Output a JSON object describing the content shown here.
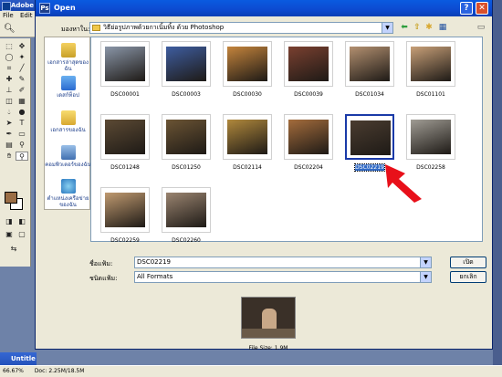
{
  "photoshop": {
    "title": "Adobe P",
    "menu": [
      "File",
      "Edit",
      "I"
    ],
    "doc_tab": "Untitle",
    "status": [
      "66.67%",
      "Doc: 2.25M/18.5M"
    ]
  },
  "dialog": {
    "title": "Open",
    "help": "?",
    "close": "✕",
    "look_in_label": "มองหาใน:",
    "look_in_value": "วิธีย่อรูปภาพด้วยกาเนิ้มทิ้ง ด้วย Photoshop",
    "places": [
      {
        "label": "เอกสารล่าสุดของฉัน",
        "icon": "recent-documents-icon"
      },
      {
        "label": "เดสก์ท็อป",
        "icon": "desktop-icon"
      },
      {
        "label": "เอกสารของฉัน",
        "icon": "my-documents-icon"
      },
      {
        "label": "คอมพิวเตอร์ของฉัน",
        "icon": "my-computer-icon"
      },
      {
        "label": "ตำแหน่งเครือข่ายของฉัน",
        "icon": "network-places-icon"
      }
    ],
    "files": [
      {
        "name": "DSC00001",
        "color": "#8a96a8"
      },
      {
        "name": "DSC00003",
        "color": "#3e5da0"
      },
      {
        "name": "DSC00030",
        "color": "#c4843c"
      },
      {
        "name": "DSC00039",
        "color": "#7a4030"
      },
      {
        "name": "DSC01034",
        "color": "#b39070"
      },
      {
        "name": "DSC01101",
        "color": "#c8a078"
      },
      {
        "name": "DSC01248",
        "color": "#5c4a34"
      },
      {
        "name": "DSC01250",
        "color": "#6b5434"
      },
      {
        "name": "DSC02114",
        "color": "#b0883c"
      },
      {
        "name": "DSC02204",
        "color": "#a46c3c"
      },
      {
        "name": "DSC02219",
        "color": "#4a3c30",
        "selected": true
      },
      {
        "name": "DSC02258",
        "color": "#a09c94"
      },
      {
        "name": "DSC02259",
        "color": "#c09a70"
      },
      {
        "name": "DSC02260",
        "color": "#9a8470"
      }
    ],
    "file_name_label": "ชื่อแฟ้ม:",
    "file_name_value": "DSC02219",
    "file_type_label": "ชนิดแฟ้ม:",
    "file_type_value": "All Formats",
    "open_button": "เปิด",
    "cancel_button": "ยกเลิก",
    "file_size": "File Size: 1.9M"
  },
  "colors": {
    "accent": "#316ac5",
    "arrow": "#e8101a"
  }
}
